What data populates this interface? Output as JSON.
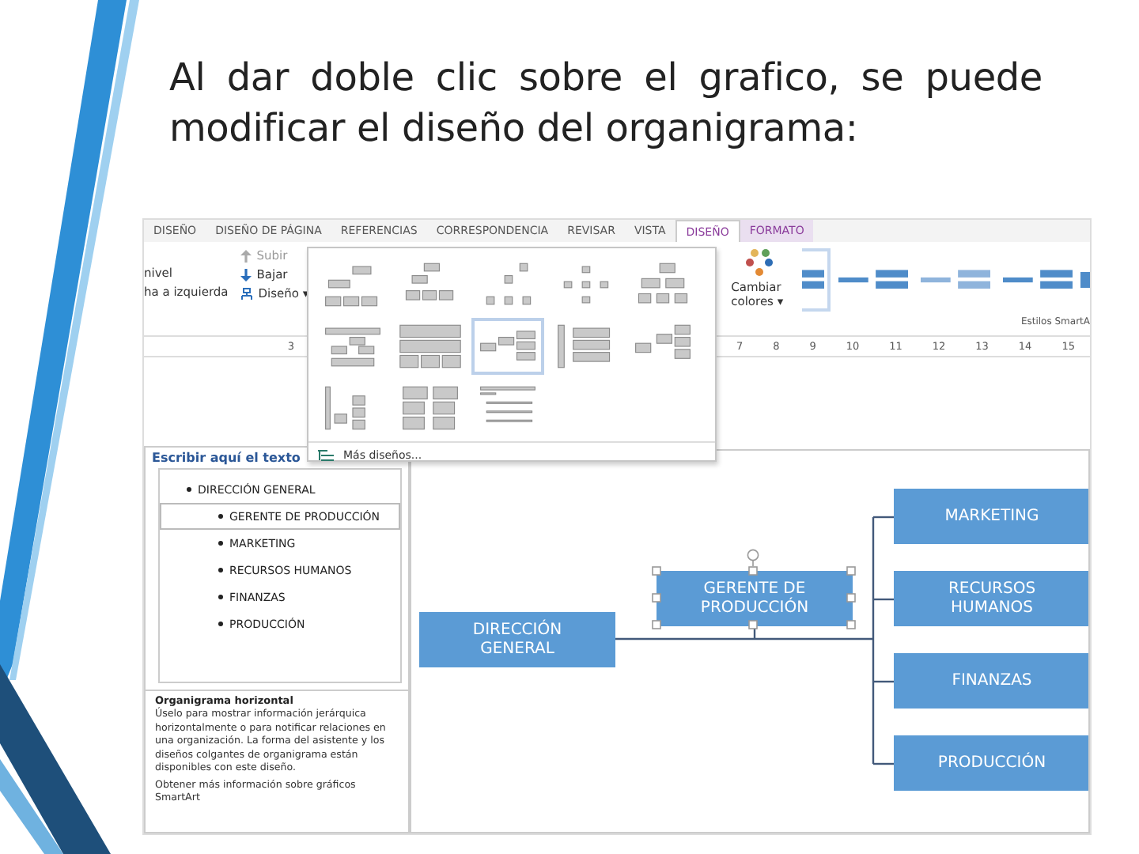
{
  "slide": {
    "title": "Al dar doble clic sobre el grafico, se puede modificar el diseño del organigrama:"
  },
  "ribbon": {
    "tabs": [
      {
        "label": "DISEÑO",
        "selected": false,
        "contextual": false
      },
      {
        "label": "DISEÑO DE PÁGINA",
        "selected": false,
        "contextual": false
      },
      {
        "label": "REFERENCIAS",
        "selected": false,
        "contextual": false
      },
      {
        "label": "CORRESPONDENCIA",
        "selected": false,
        "contextual": false
      },
      {
        "label": "REVISAR",
        "selected": false,
        "contextual": false
      },
      {
        "label": "VISTA",
        "selected": false,
        "contextual": false
      },
      {
        "label": "DISEÑO",
        "selected": true,
        "contextual": true
      },
      {
        "label": "FORMATO",
        "selected": false,
        "contextual": true
      }
    ],
    "cut_commands": [
      "nivel",
      "ha a izquierda"
    ],
    "commands": [
      {
        "kind": "up",
        "label": "Subir",
        "disabled": true
      },
      {
        "kind": "down",
        "label": "Bajar",
        "disabled": false
      },
      {
        "kind": "layout",
        "label": "Diseño ▾",
        "disabled": false
      }
    ],
    "change_colors": "Cambiar colores ▾",
    "styles": [
      {
        "selected": true
      },
      {
        "selected": false
      },
      {
        "selected": false
      },
      {
        "selected": false
      }
    ],
    "styles_group_label": "Estilos SmartA"
  },
  "ruler": {
    "left_numbers": [
      "3"
    ],
    "right_numbers": [
      "7",
      "8",
      "9",
      "10",
      "11",
      "12",
      "13",
      "14",
      "15"
    ]
  },
  "layout_gallery": {
    "layouts": [
      {
        "selected": false
      },
      {
        "selected": false
      },
      {
        "selected": false
      },
      {
        "selected": false
      },
      {
        "selected": false
      },
      {
        "selected": false
      },
      {
        "selected": false
      },
      {
        "selected": true
      },
      {
        "selected": false
      },
      {
        "selected": false
      },
      {
        "selected": false
      },
      {
        "selected": false
      },
      {
        "selected": false
      }
    ],
    "more": "Más diseños..."
  },
  "text_pane": {
    "title": "Escribir aquí el texto",
    "items": [
      {
        "label": "DIRECCIÓN GENERAL",
        "selected": false,
        "children": [
          {
            "label": "GERENTE DE PRODUCCIÓN",
            "selected": true
          },
          {
            "label": "MARKETING",
            "selected": false
          },
          {
            "label": "RECURSOS HUMANOS",
            "selected": false
          },
          {
            "label": "FINANZAS",
            "selected": false
          },
          {
            "label": "PRODUCCIÓN",
            "selected": false
          }
        ]
      }
    ],
    "description_title": "Organigrama horizontal",
    "description": "Úselo para mostrar información jerárquica horizontalmente o para notificar relaciones en una organización. La forma del asistente y los diseños colgantes de organigrama están disponibles con este diseño.",
    "link": "Obtener más información sobre gráficos SmartArt"
  },
  "diagram": {
    "nodes": [
      {
        "label": "DIRECCIÓN GENERAL",
        "kind": "root",
        "selected": false
      },
      {
        "label": "GERENTE DE PRODUCCIÓN",
        "kind": "assistant",
        "selected": true
      },
      {
        "label": "MARKETING",
        "kind": "child",
        "selected": false
      },
      {
        "label": "RECURSOS HUMANOS",
        "kind": "child",
        "selected": false
      },
      {
        "label": "FINANZAS",
        "kind": "child",
        "selected": false
      },
      {
        "label": "PRODUCCIÓN",
        "kind": "child",
        "selected": false
      }
    ]
  }
}
